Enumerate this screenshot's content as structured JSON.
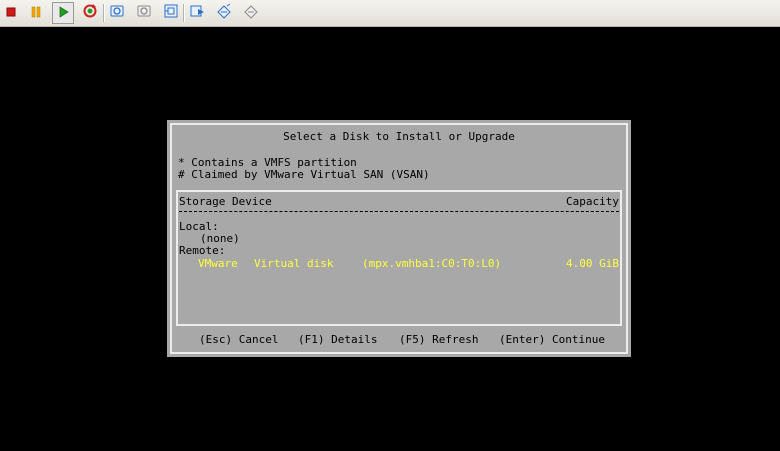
{
  "toolbar": {
    "buttons": [
      {
        "icon": "stop-icon",
        "color": "#d01818"
      },
      {
        "icon": "pause-icon",
        "color": "#f0a800"
      },
      {
        "icon": "play-icon",
        "color": "#22a022",
        "active": true
      },
      {
        "icon": "reset-icon",
        "color": "#cc2222"
      },
      {
        "icon": "snapshot-icon",
        "color": "#2a6fc8"
      },
      {
        "icon": "revert-snapshot-icon",
        "color": "#8a8a8a"
      },
      {
        "icon": "snapshot-manager-icon",
        "color": "#2a6fc8"
      },
      {
        "icon": "settings-icon",
        "color": "#2a6fc8"
      },
      {
        "icon": "connect-device-icon",
        "color": "#2a6fc8"
      },
      {
        "icon": "disconnect-device-icon",
        "color": "#8a8a8a"
      }
    ]
  },
  "dialog": {
    "title": "Select a Disk to Install or Upgrade",
    "legend": [
      "* Contains a VMFS partition",
      "# Claimed by VMware Virtual SAN (VSAN)"
    ],
    "columns": {
      "device": "Storage Device",
      "capacity": "Capacity"
    },
    "local_label": "Local:",
    "local_none": "(none)",
    "remote_label": "Remote:",
    "remote_disk": {
      "vendor": "VMware",
      "model": "Virtual disk",
      "path": "(mpx.vmhba1:C0:T0:L0)",
      "capacity": "4.00 GiB"
    },
    "footer": {
      "cancel": "(Esc) Cancel",
      "details": "(F1) Details",
      "refresh": "(F5) Refresh",
      "continue": "(Enter) Continue"
    }
  },
  "colors": {
    "dialog_bg": "#a8a8a8",
    "highlight_text": "#ffff3c",
    "console_bg": "#000000"
  }
}
